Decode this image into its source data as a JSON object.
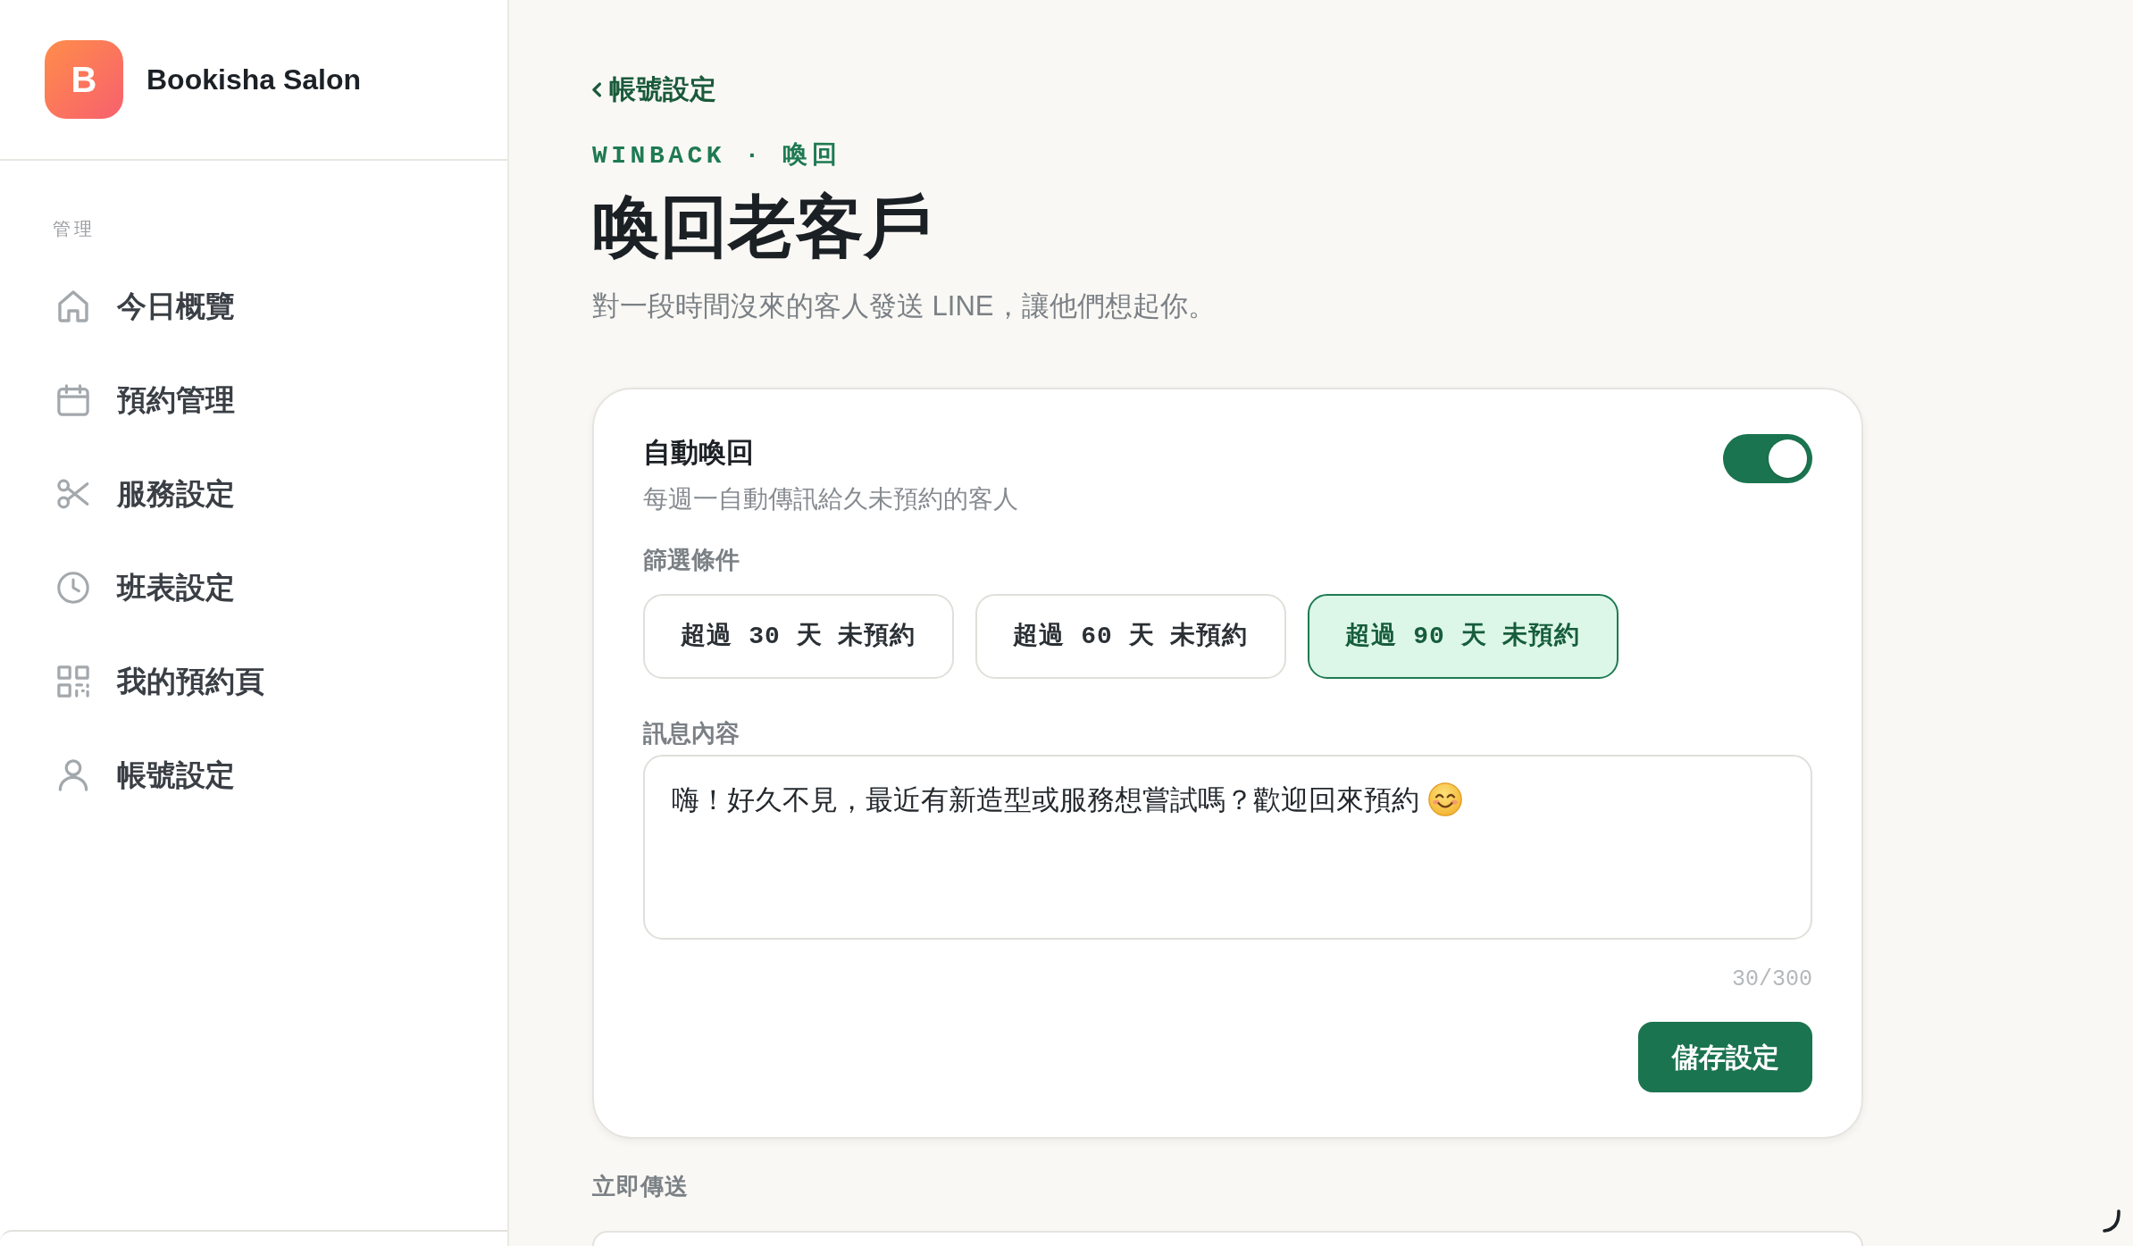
{
  "sidebar": {
    "brand": {
      "logo_letter": "B",
      "name": "Bookisha Salon"
    },
    "section_label": "管理",
    "items": [
      {
        "label": "今日概覽",
        "selected": false
      },
      {
        "label": "預約管理",
        "selected": false
      },
      {
        "label": "服務設定",
        "selected": false
      },
      {
        "label": "班表設定",
        "selected": false
      },
      {
        "label": "我的預約頁",
        "selected": false
      },
      {
        "label": "帳號設定",
        "selected": false
      }
    ]
  },
  "main": {
    "back_link": "帳號設定",
    "eyebrow": "WINBACK · 喚回",
    "title": "喚回老客戶",
    "subtitle": "對一段時間沒來的客人發送 LINE，讓他們想起你。",
    "auto_card": {
      "title": "自動喚回",
      "description": "每週一自動傳訊給久未預約的客人",
      "toggle": {
        "on": true
      },
      "filter_label": "篩選條件",
      "filters": [
        {
          "label": "超過 30 天 未預約",
          "selected": false
        },
        {
          "label": "超過 60 天 未預約",
          "selected": false
        },
        {
          "label": "超過 90 天 未預約",
          "selected": true
        }
      ],
      "message_label": "訊息內容",
      "message": {
        "value": "嗨！好久不見，最近有新造型或服務想嘗試嗎？歡迎回來預約"
      },
      "counter": "30/300",
      "save_button": "儲存設定"
    },
    "send_now": {
      "label": "立即傳送"
    }
  }
}
